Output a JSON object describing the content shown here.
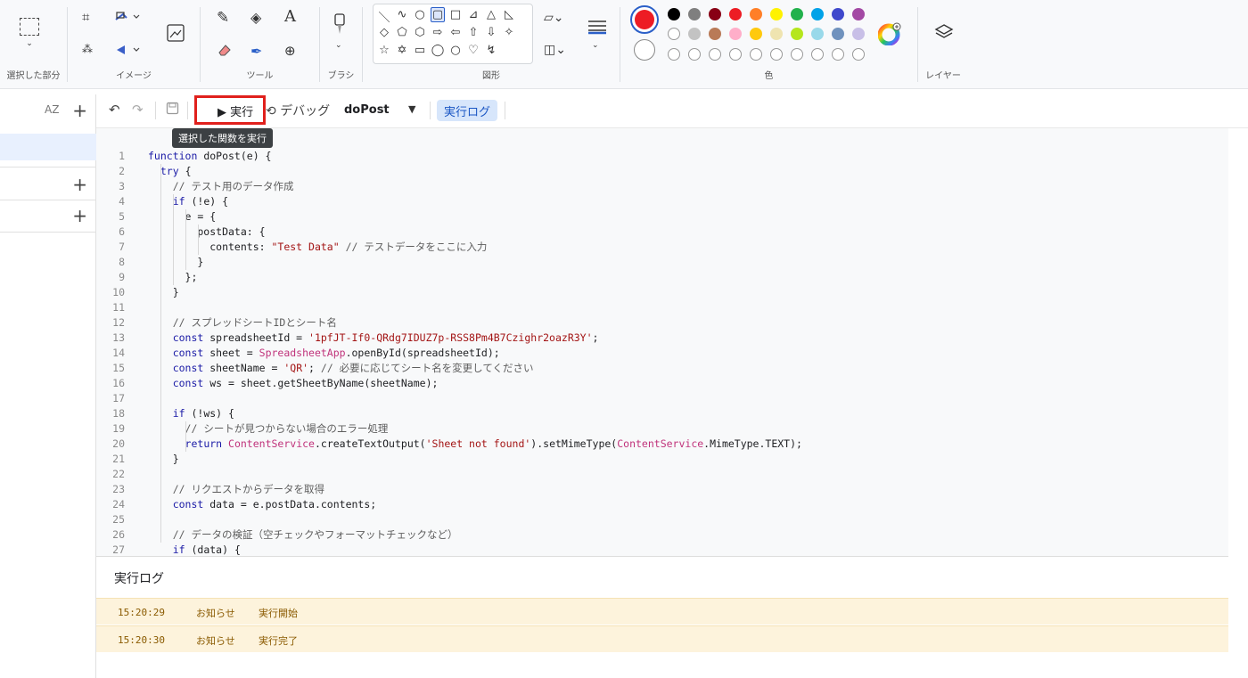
{
  "ribbon": {
    "groups": {
      "selection": "選択した部分",
      "image": "イメージ",
      "tools": "ツール",
      "brush": "ブラシ",
      "shapes": "図形",
      "colors": "色",
      "layers": "レイヤー"
    },
    "text_tool_glyph": "A",
    "palette_row1": [
      "#000000",
      "#7f7f7f",
      "#880015",
      "#ed1c24",
      "#ff7f27",
      "#fff200",
      "#22b14c",
      "#00a2e8",
      "#3f48cc",
      "#a349a4"
    ],
    "palette_row2": [
      "#c3c3c3",
      "#b97a57",
      "#ffaec9",
      "#ffc90e",
      "#efe4b0",
      "#b5e61d",
      "#99d9ea",
      "#7092be",
      "#c8bfe7"
    ],
    "primary_color": "#ed1c24",
    "secondary_color": "#ffffff"
  },
  "editor": {
    "toolbar": {
      "sort_label": "AZ",
      "run_label": "▶ 実行",
      "debug_label": "デバッグ",
      "function_name": "doPost",
      "log_label": "実行ログ"
    },
    "tooltip": "選択した関数を実行",
    "code_lines": [
      "function doPost(e) {",
      "  try {",
      "    // テスト用のデータ作成",
      "    if (!e) {",
      "      e = {",
      "        postData: {",
      "          contents: \"Test Data\" // テストデータをここに入力",
      "        }",
      "      };",
      "    }",
      "",
      "    // スプレッドシートIDとシート名",
      "    const spreadsheetId = '1pfJT-If0-QRdg7IDUZ7p-RSS8Pm4B7Czighr2oazR3Y';",
      "    const sheet = SpreadsheetApp.openById(spreadsheetId);",
      "    const sheetName = 'QR'; // 必要に応じてシート名を変更してください",
      "    const ws = sheet.getSheetByName(sheetName);",
      "",
      "    if (!ws) {",
      "      // シートが見つからない場合のエラー処理",
      "      return ContentService.createTextOutput('Sheet not found').setMimeType(ContentService.MimeType.TEXT);",
      "    }",
      "",
      "    // リクエストからデータを取得",
      "    const data = e.postData.contents;",
      "",
      "    // データの検証（空チェックやフォーマットチェックなど）",
      "    if (data) {"
    ],
    "log": {
      "title": "実行ログ",
      "entries": [
        {
          "time": "15:20:29",
          "level": "お知らせ",
          "message": "実行開始"
        },
        {
          "time": "15:20:30",
          "level": "お知らせ",
          "message": "実行完了"
        }
      ]
    }
  }
}
